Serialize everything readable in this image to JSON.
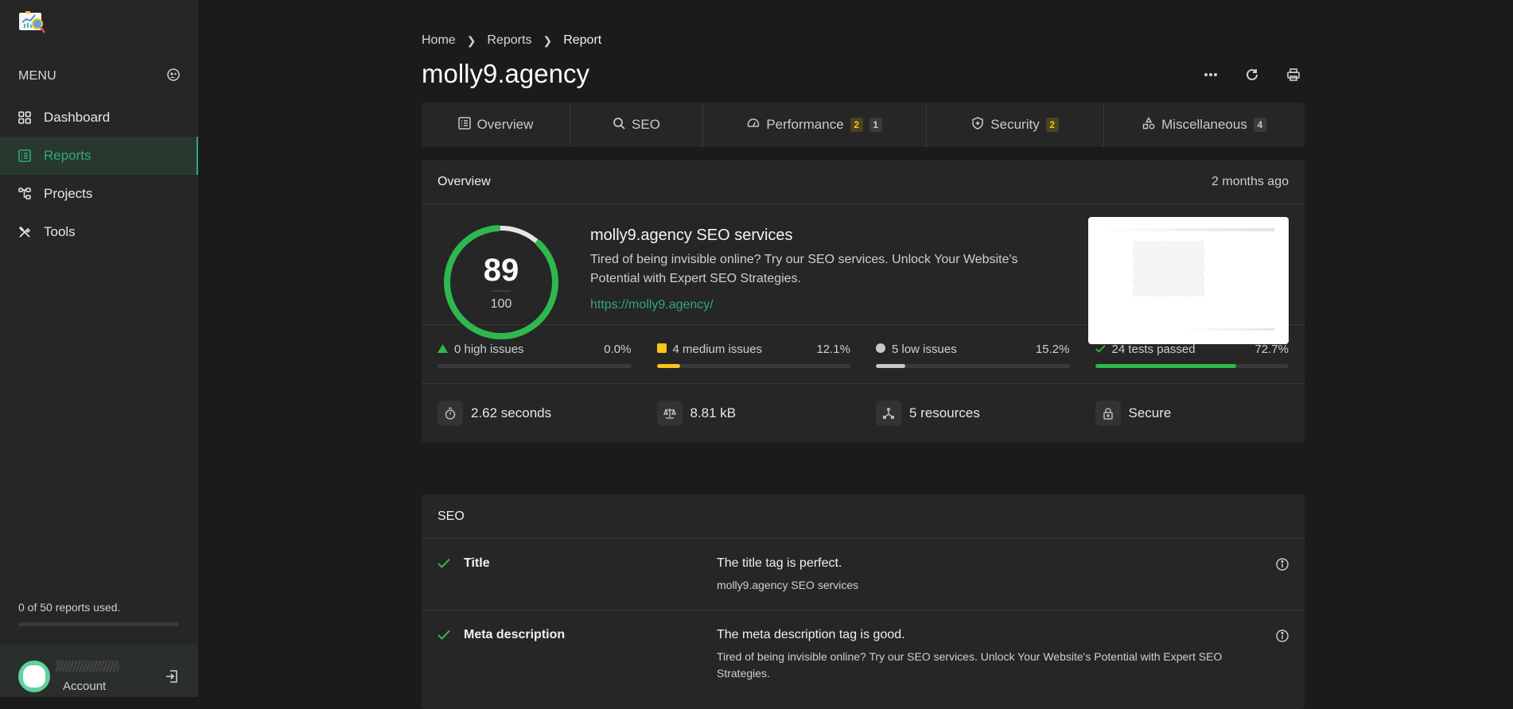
{
  "sidebar": {
    "menu_label": "MENU",
    "items": [
      {
        "label": "Dashboard",
        "icon": "grid-icon",
        "active": false
      },
      {
        "label": "Reports",
        "icon": "list-icon",
        "active": true
      },
      {
        "label": "Projects",
        "icon": "hierarchy-icon",
        "active": false
      },
      {
        "label": "Tools",
        "icon": "tools-icon",
        "active": false
      }
    ],
    "usage_text": "0 of 50 reports used.",
    "usage_fraction": 0,
    "account_label": "Account"
  },
  "breadcrumb": [
    "Home",
    "Reports",
    "Report"
  ],
  "page_title": "molly9.agency",
  "tabs": [
    {
      "label": "Overview",
      "icon": "list-icon",
      "badges": []
    },
    {
      "label": "SEO",
      "icon": "search-icon",
      "badges": []
    },
    {
      "label": "Performance",
      "icon": "gauge-icon",
      "badges": [
        {
          "value": "2",
          "kind": "medium"
        },
        {
          "value": "1",
          "kind": "low"
        }
      ]
    },
    {
      "label": "Security",
      "icon": "shield-icon",
      "badges": [
        {
          "value": "2",
          "kind": "medium"
        }
      ]
    },
    {
      "label": "Miscellaneous",
      "icon": "shapes-icon",
      "badges": [
        {
          "value": "4",
          "kind": "low"
        }
      ]
    }
  ],
  "overview": {
    "heading": "Overview",
    "time": "2 months ago",
    "score": "89",
    "score_max": "100",
    "score_fraction": 0.89,
    "site_title": "molly9.agency SEO services",
    "site_description": "Tired of being invisible online? Try our SEO services. Unlock Your Website's Potential with Expert SEO Strategies.",
    "site_url": "https://molly9.agency/",
    "issues": [
      {
        "label": "0 high issues",
        "percent": "0.0%",
        "fraction": 0.0,
        "color": "#2fb84f",
        "icon": "triangle-icon"
      },
      {
        "label": "4 medium issues",
        "percent": "12.1%",
        "fraction": 0.121,
        "color": "#f5c518",
        "icon": "square-icon"
      },
      {
        "label": "5 low issues",
        "percent": "15.2%",
        "fraction": 0.152,
        "color": "#c8c8c8",
        "icon": "circle-icon"
      },
      {
        "label": "24 tests passed",
        "percent": "72.7%",
        "fraction": 0.727,
        "color": "#2fb84f",
        "icon": "check-icon"
      }
    ],
    "stats": [
      {
        "value": "2.62 seconds",
        "icon": "stopwatch-icon"
      },
      {
        "value": "8.81 kB",
        "icon": "scale-icon"
      },
      {
        "value": "5 resources",
        "icon": "network-icon"
      },
      {
        "value": "Secure",
        "icon": "lock-icon"
      }
    ]
  },
  "seo": {
    "heading": "SEO",
    "rows": [
      {
        "name": "Title",
        "message": "The title tag is perfect.",
        "detail": "molly9.agency SEO services"
      },
      {
        "name": "Meta description",
        "message": "The meta description tag is good.",
        "detail": "Tired of being invisible online? Try our SEO services. Unlock Your Website's Potential with Expert SEO Strategies."
      }
    ]
  },
  "colors": {
    "accent": "#2ea87a",
    "success": "#2fb84f",
    "warning": "#f5c518"
  }
}
